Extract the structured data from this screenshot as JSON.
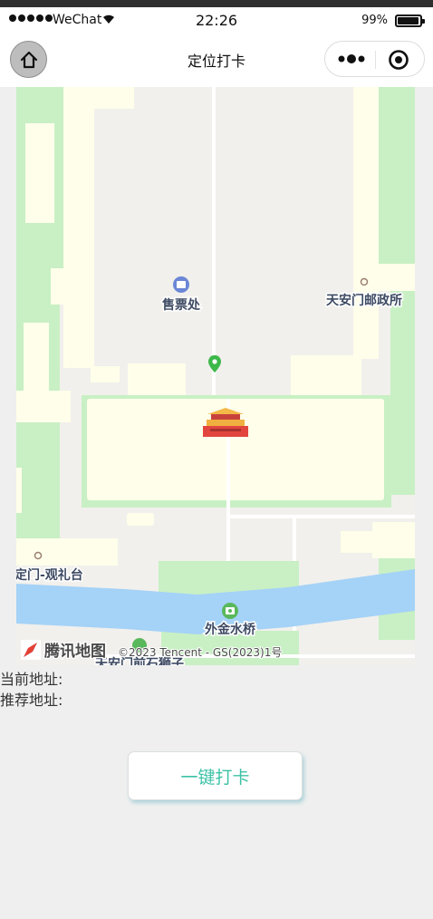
{
  "status_bar": {
    "carrier": "WeChat",
    "time": "22:26",
    "battery": "99%"
  },
  "nav": {
    "title": "定位打卡"
  },
  "map": {
    "labels": {
      "ticket": "售票处",
      "post_office": "天安门邮政所",
      "observation": "定门-观礼台",
      "bridge": "外金水桥",
      "lion": "天安门前石狮子"
    },
    "brand": "腾讯地图",
    "copyright": "©2023 Tencent - GS(2023)1号"
  },
  "address": {
    "current_label": "当前地址:",
    "recommended_label": "推荐地址:"
  },
  "checkin": {
    "button_label": "一键打卡"
  },
  "colors": {
    "accent": "#3cc2a6",
    "water": "#a5d2f7",
    "park": "#c8f0c4",
    "building": "#fefeea"
  }
}
